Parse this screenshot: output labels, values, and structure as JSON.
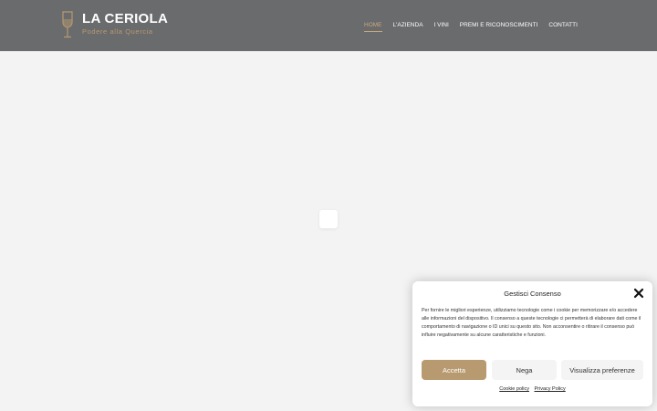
{
  "header": {
    "logo_title": "LA CERIOLA",
    "logo_subtitle": "Podere alla Quercia",
    "nav": [
      {
        "label": "HOME",
        "active": true
      },
      {
        "label": "L'AZIENDA",
        "active": false
      },
      {
        "label": "I VINI",
        "active": false
      },
      {
        "label": "PREMI E RICONOSCIMENTI",
        "active": false
      },
      {
        "label": "CONTATTI",
        "active": false
      }
    ]
  },
  "cookie_banner": {
    "title": "Gestisci Consenso",
    "text": "Per fornire le migliori esperienze, utilizziamo tecnologie come i cookie per memorizzare e/o accedere alle informazioni del dispositivo. Il consenso a queste tecnologie ci permetterà di elaborare dati come il comportamento di navigazione o ID unici su questo sito. Non acconsentire o ritirare il consenso può influire negativamente su alcune caratteristiche e funzioni.",
    "accept_label": "Accetta",
    "deny_label": "Nega",
    "prefs_label": "Visualizza preferenze",
    "cookie_policy_label": "Cookie policy",
    "privacy_policy_label": "Privacy Policy"
  },
  "colors": {
    "header_bg": "#6a6b6d",
    "accent": "#b89a70",
    "page_bg": "#f3f3f3"
  },
  "icons": [
    "wine-glass-icon",
    "close-icon"
  ]
}
